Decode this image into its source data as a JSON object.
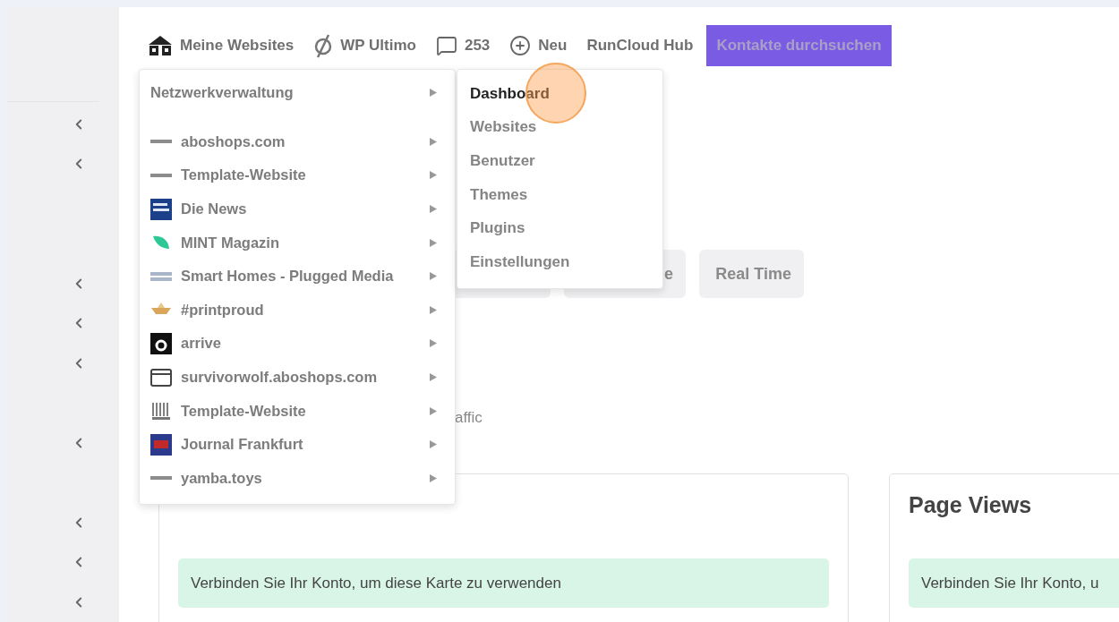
{
  "sidebar": {
    "items": [
      {
        "kind": "active"
      },
      {
        "kind": "collapsible"
      },
      {
        "kind": "collapsible"
      },
      {
        "kind": "gap"
      },
      {
        "kind": "gap"
      },
      {
        "kind": "collapsible"
      },
      {
        "kind": "collapsible"
      },
      {
        "kind": "collapsible"
      },
      {
        "kind": "gap"
      },
      {
        "kind": "collapsible"
      },
      {
        "kind": "gap"
      },
      {
        "kind": "collapsible"
      },
      {
        "kind": "collapsible"
      },
      {
        "kind": "collapsible"
      }
    ]
  },
  "admin_bar": {
    "items": [
      {
        "kind": "sites",
        "label": "Meine Websites"
      },
      {
        "kind": "ultimo",
        "label": "WP Ultimo"
      },
      {
        "kind": "comments",
        "label": "253"
      },
      {
        "kind": "new",
        "label": "Neu"
      },
      {
        "kind": "plain",
        "label": "RunCloud Hub"
      }
    ],
    "search_button": "Kontakte durchsuchen"
  },
  "sites_menu": {
    "network": "Netzwerkverwaltung",
    "sites": [
      {
        "kind": "wordmark",
        "label": "aboshops.com"
      },
      {
        "kind": "wordmark",
        "label": "Template-Website"
      },
      {
        "kind": "newspaper",
        "label": "Die News"
      },
      {
        "kind": "leaf",
        "label": "MINT Magazin"
      },
      {
        "kind": "faded",
        "label": "Smart Homes - Plugged Media"
      },
      {
        "kind": "boat",
        "label": "#printproud"
      },
      {
        "kind": "letter",
        "label": "arrive"
      },
      {
        "kind": "window",
        "label": "survivorwolf.aboshops.com"
      },
      {
        "kind": "sketch",
        "label": "Template-Website"
      },
      {
        "kind": "poster",
        "label": "Journal Frankfurt"
      },
      {
        "kind": "wordmark",
        "label": "yamba.toys"
      }
    ]
  },
  "network_submenu": [
    {
      "label": "Dashboard",
      "selected": true
    },
    {
      "label": "Websites",
      "selected": false
    },
    {
      "label": "Benutzer",
      "selected": false
    },
    {
      "label": "Themes",
      "selected": false
    },
    {
      "label": "Plugins",
      "selected": false
    },
    {
      "label": "Einstellungen",
      "selected": false
    }
  ],
  "filter_tabs": [
    {
      "label": "e"
    },
    {
      "label": "Real Time"
    }
  ],
  "section_text": "affic",
  "cards": [
    {
      "notice": "Verbinden Sie Ihr Konto, um diese Karte zu verwenden"
    },
    {
      "title": "Page Views",
      "notice": "Verbinden Sie Ihr Konto, u"
    }
  ]
}
